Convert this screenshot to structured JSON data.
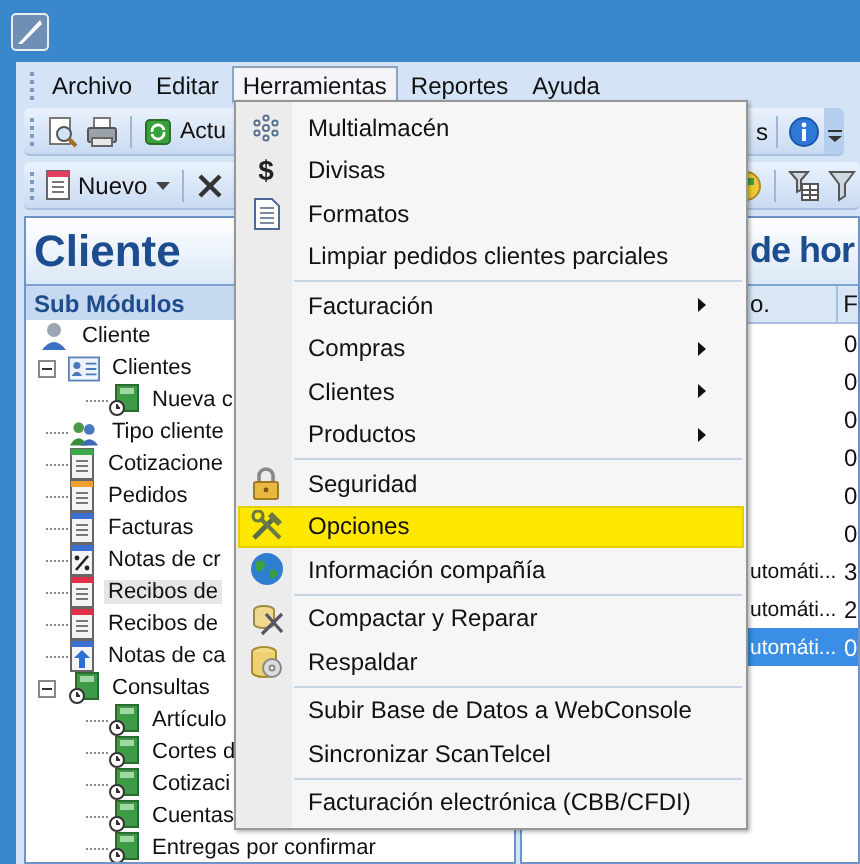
{
  "menu_bar": [
    {
      "label": "Archivo",
      "open": false
    },
    {
      "label": "Editar",
      "open": false
    },
    {
      "label": "Herramientas",
      "open": true
    },
    {
      "label": "Reportes",
      "open": false
    },
    {
      "label": "Ayuda",
      "open": false
    }
  ],
  "toolbar_1": {
    "left_label": "Actu",
    "right_label": "s"
  },
  "toolbar_2": {
    "new_button": "Nuevo"
  },
  "left_panel": {
    "title": "Cliente",
    "subheader": "Sub Módulos",
    "tree": [
      {
        "label": "Cliente",
        "kind": "user",
        "highlighted": false,
        "children": [
          {
            "label": "Clientes",
            "kind": "contacts",
            "highlighted": false,
            "expanded": true,
            "children": [
              {
                "label": "Nueva c",
                "kind": "query",
                "highlighted": false
              }
            ]
          },
          {
            "label": "Tipo cliente",
            "kind": "group",
            "highlighted": false
          },
          {
            "label": "Cotizacione",
            "kind": "document",
            "color": "#3aa84a",
            "highlighted": false
          },
          {
            "label": "Pedidos",
            "kind": "document",
            "color": "#f0a030",
            "highlighted": false
          },
          {
            "label": "Facturas",
            "kind": "document",
            "color": "#3b6fd0",
            "highlighted": false
          },
          {
            "label": "Notas de cr",
            "kind": "percent",
            "highlighted": false
          },
          {
            "label": "Recibos de",
            "kind": "document",
            "color": "#e0304a",
            "highlighted": true
          },
          {
            "label": "Recibos de",
            "kind": "document",
            "color": "#e0304a",
            "highlighted": false
          },
          {
            "label": "Notas de ca",
            "kind": "upload",
            "highlighted": false
          },
          {
            "label": "Consultas",
            "kind": "query",
            "highlighted": false,
            "expanded": true,
            "children": [
              {
                "label": "Artículo",
                "kind": "query",
                "highlighted": false
              },
              {
                "label": "Cortes d",
                "kind": "query",
                "highlighted": false
              },
              {
                "label": "Cotizaci",
                "kind": "query",
                "highlighted": false
              },
              {
                "label": "Cuentas",
                "kind": "query",
                "highlighted": false
              },
              {
                "label": "Entregas por confirmar",
                "kind": "query",
                "highlighted": false
              }
            ]
          }
        ]
      }
    ]
  },
  "right_panel": {
    "title": "de hor",
    "column_headers": [
      "o.",
      "F"
    ],
    "rows": [
      {
        "column_2": "0",
        "selected": false
      },
      {
        "column_2": "0",
        "selected": false
      },
      {
        "column_2": "0",
        "selected": false
      },
      {
        "column_2": "0",
        "selected": false
      },
      {
        "column_2": "0",
        "selected": false
      },
      {
        "column_2": "0",
        "selected": false
      },
      {
        "column_1": "utomáti...",
        "column_2": "3",
        "selected": false
      },
      {
        "column_1": "utomáti...",
        "column_2": "2",
        "selected": false
      },
      {
        "column_1": "utomáti...",
        "column_2": "0",
        "selected": true
      }
    ]
  },
  "dropdown_menu": [
    {
      "kind": "item",
      "label": "Multialmacén",
      "submenu": false,
      "highlighted": false
    },
    {
      "kind": "item",
      "label": "Divisas",
      "icon_glyph": "$",
      "submenu": false,
      "highlighted": false
    },
    {
      "kind": "item",
      "label": "Formatos",
      "submenu": false,
      "highlighted": false
    },
    {
      "kind": "item",
      "label": "Limpiar pedidos clientes parciales",
      "submenu": false,
      "highlighted": false
    },
    {
      "kind": "separator"
    },
    {
      "kind": "item",
      "label": "Facturación",
      "submenu": true,
      "highlighted": false
    },
    {
      "kind": "item",
      "label": "Compras",
      "submenu": true,
      "highlighted": false
    },
    {
      "kind": "item",
      "label": "Clientes",
      "submenu": true,
      "highlighted": false
    },
    {
      "kind": "item",
      "label": "Productos",
      "submenu": true,
      "highlighted": false
    },
    {
      "kind": "separator"
    },
    {
      "kind": "item",
      "label": "Seguridad",
      "submenu": false,
      "highlighted": false
    },
    {
      "kind": "item",
      "label": "Opciones",
      "submenu": false,
      "highlighted": true
    },
    {
      "kind": "item",
      "label": "Información compañía",
      "submenu": false,
      "highlighted": false
    },
    {
      "kind": "separator"
    },
    {
      "kind": "item",
      "label": "Compactar y Reparar",
      "submenu": false,
      "highlighted": false
    },
    {
      "kind": "item",
      "label": "Respaldar",
      "submenu": false,
      "highlighted": false
    },
    {
      "kind": "separator"
    },
    {
      "kind": "item",
      "label": "Subir Base de Datos a WebConsole",
      "submenu": false,
      "highlighted": false
    },
    {
      "kind": "item",
      "label": "Sincronizar ScanTelcel",
      "submenu": false,
      "highlighted": false
    },
    {
      "kind": "separator"
    },
    {
      "kind": "item",
      "label": "Facturación electrónica (CBB/CFDI)",
      "submenu": false,
      "highlighted": false
    }
  ]
}
